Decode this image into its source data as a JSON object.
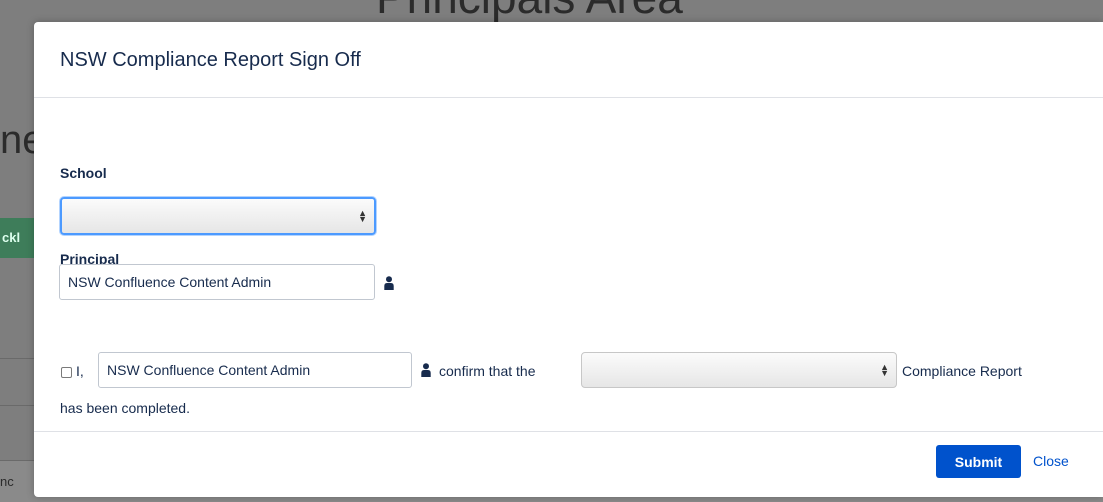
{
  "background": {
    "page_title": "Principals Area",
    "heading_fragment": "nе",
    "button_fragment": "ckl",
    "cell_fragment": "nc"
  },
  "modal": {
    "title": "NSW Compliance Report Sign Off",
    "school": {
      "label": "School",
      "selected_value": ""
    },
    "principal": {
      "label": "Principal",
      "value": "NSW Confluence Content Admin",
      "icon": "user-icon"
    },
    "confirmation": {
      "checked": false,
      "prefix": "I,",
      "name_value": "NSW Confluence Content Admin",
      "middle": "confirm that the",
      "report_type_value": "",
      "suffix": "Compliance Report",
      "line2": "has been completed."
    },
    "footer": {
      "submit_label": "Submit",
      "close_label": "Close"
    },
    "colors": {
      "primary": "#0052cc",
      "focus": "#4c9aff",
      "text": "#172b4d"
    }
  }
}
